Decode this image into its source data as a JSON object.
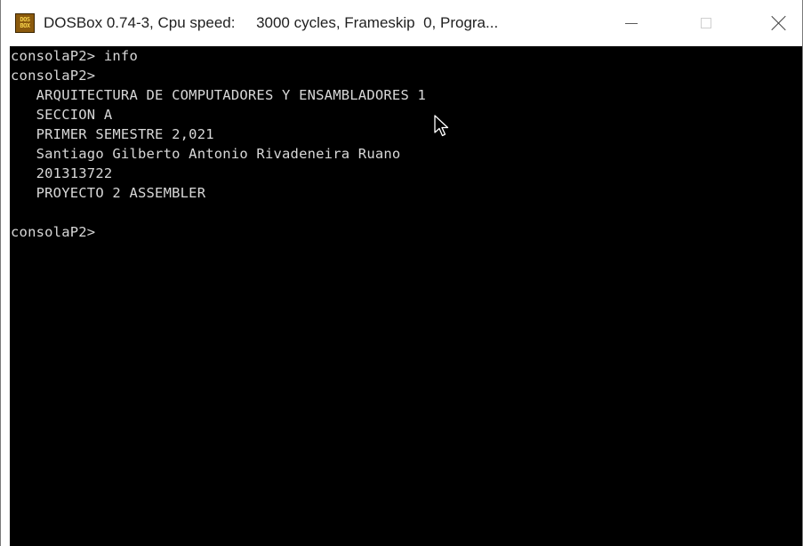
{
  "window": {
    "title": "DOSBox 0.74-3, Cpu speed:     3000 cycles, Frameskip  0, Progra...",
    "icon_text_top": "DOS",
    "icon_text_bottom": "BOX",
    "icons": {
      "app": "dosbox-icon",
      "minimize": "minimize-icon",
      "maximize": "maximize-icon",
      "close": "close-icon"
    }
  },
  "console": {
    "lines": [
      "consolaP2> info",
      "consolaP2>",
      "   ARQUITECTURA DE COMPUTADORES Y ENSAMBLADORES 1",
      "   SECCION A",
      "   PRIMER SEMESTRE 2,021",
      "   Santiago Gilberto Antonio Rivadeneira Ruano",
      "   201313722",
      "   PROYECTO 2 ASSEMBLER",
      "",
      "consolaP2>"
    ],
    "background": "#000000",
    "foreground": "#d8d8d8"
  }
}
